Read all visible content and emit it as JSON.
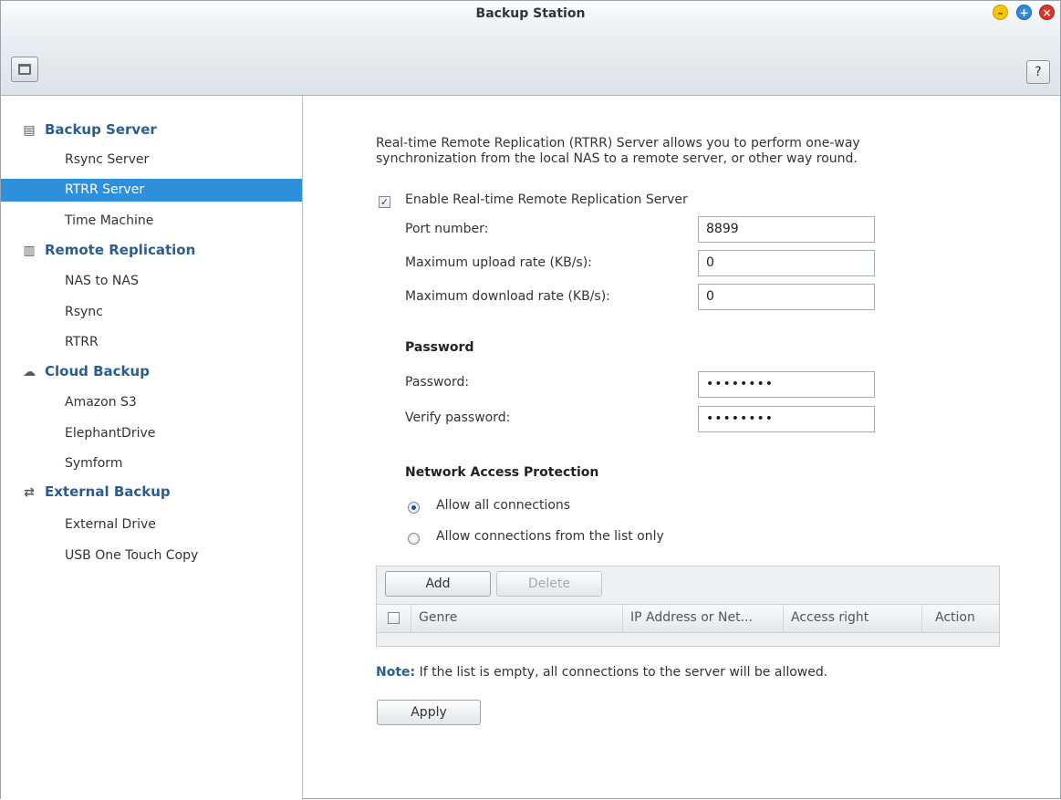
{
  "window": {
    "title": "Backup Station",
    "help_label": "?"
  },
  "sidebar": {
    "groups": [
      {
        "label": "Backup Server",
        "icon": "server-icon",
        "items": [
          {
            "label": "Rsync Server"
          },
          {
            "label": "RTRR Server",
            "selected": true
          },
          {
            "label": "Time Machine"
          }
        ]
      },
      {
        "label": "Remote Replication",
        "icon": "replication-icon",
        "items": [
          {
            "label": "NAS to NAS"
          },
          {
            "label": "Rsync"
          },
          {
            "label": "RTRR"
          }
        ]
      },
      {
        "label": "Cloud Backup",
        "icon": "cloud-icon",
        "items": [
          {
            "label": "Amazon S3"
          },
          {
            "label": "ElephantDrive"
          },
          {
            "label": "Symform"
          }
        ]
      },
      {
        "label": "External Backup",
        "icon": "sync-arrows-icon",
        "items": [
          {
            "label": "External Drive"
          },
          {
            "label": "USB One Touch Copy"
          }
        ]
      }
    ]
  },
  "main": {
    "description_line1": "Real-time Remote Replication (RTRR) Server allows you to perform one-way",
    "description_line2": "synchronization from the local NAS to a remote server, or other way round.",
    "enable_label": "Enable Real-time Remote Replication Server",
    "enable_checked": true,
    "port_label": "Port number:",
    "port_value": "8899",
    "upload_label": "Maximum upload rate (KB/s):",
    "upload_value": "0",
    "download_label": "Maximum download rate (KB/s):",
    "download_value": "0",
    "password_section": "Password",
    "password_label": "Password:",
    "password_value": "••••••••",
    "verify_label": "Verify password:",
    "verify_value": "••••••••",
    "nap_section": "Network Access Protection",
    "radio_all_label": "Allow all connections",
    "radio_list_label": "Allow connections from the list only",
    "selected_radio": "all",
    "grid": {
      "add_label": "Add",
      "delete_label": "Delete",
      "columns": [
        "Genre",
        "IP Address or Net...",
        "Access right",
        "Action"
      ]
    },
    "note_prefix": "Note:",
    "note_text": " If the list is empty, all connections to the server will be allowed.",
    "apply_label": "Apply"
  }
}
